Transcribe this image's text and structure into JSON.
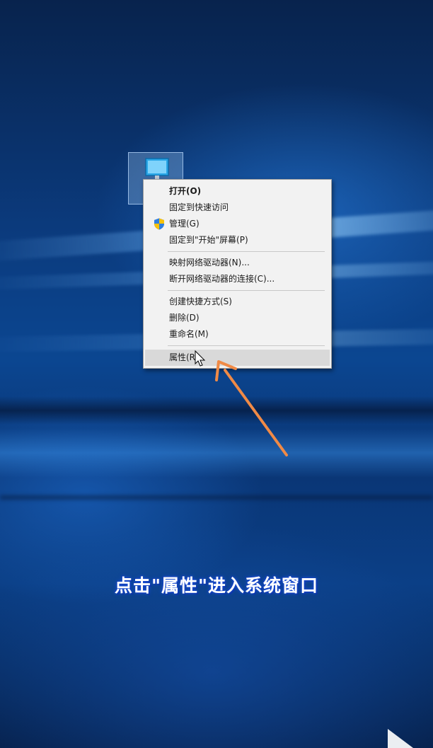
{
  "desktop": {
    "icon_label": "",
    "accent": "#0b4691"
  },
  "context_menu": {
    "items": [
      {
        "label": "打开(O)"
      },
      {
        "label": "固定到快速访问"
      },
      {
        "label": "管理(G)",
        "icon": "uac-shield-icon"
      },
      {
        "label": "固定到\"开始\"屏幕(P)"
      },
      {
        "label": "映射网络驱动器(N)..."
      },
      {
        "label": "断开网络驱动器的连接(C)..."
      },
      {
        "label": "创建快捷方式(S)"
      },
      {
        "label": "删除(D)"
      },
      {
        "label": "重命名(M)"
      },
      {
        "label": "属性(R)"
      }
    ],
    "highlighted_item": "属性(R)",
    "highlight_color": "#d9d9d9"
  },
  "annotation": {
    "arrow_color": "#f08a46",
    "caption": "点击\"属性\"进入系统窗口",
    "caption_glow": "#1a4fd6"
  }
}
